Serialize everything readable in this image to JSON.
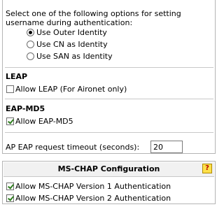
{
  "identity": {
    "prompt": "Select one of the following options for setting username during authentication:",
    "options": [
      {
        "label": "Use Outer Identity",
        "selected": true
      },
      {
        "label": "Use CN as Identity",
        "selected": false
      },
      {
        "label": "Use SAN as Identity",
        "selected": false
      }
    ]
  },
  "leap": {
    "title": "LEAP",
    "allow_label": "Allow LEAP (For Aironet only)",
    "allow_checked": false
  },
  "eap_md5": {
    "title": "EAP-MD5",
    "allow_label": "Allow EAP-MD5",
    "allow_checked": true
  },
  "timeout": {
    "label": "AP EAP request timeout (seconds):",
    "value": "20"
  },
  "ms_chap": {
    "title": "MS-CHAP Configuration",
    "help_icon": "help-icon",
    "help_glyph": "?",
    "items": [
      {
        "label": "Allow MS-CHAP Version 1 Authentication",
        "checked": true
      },
      {
        "label": "Allow MS-CHAP Version 2 Authentication",
        "checked": true
      }
    ]
  }
}
